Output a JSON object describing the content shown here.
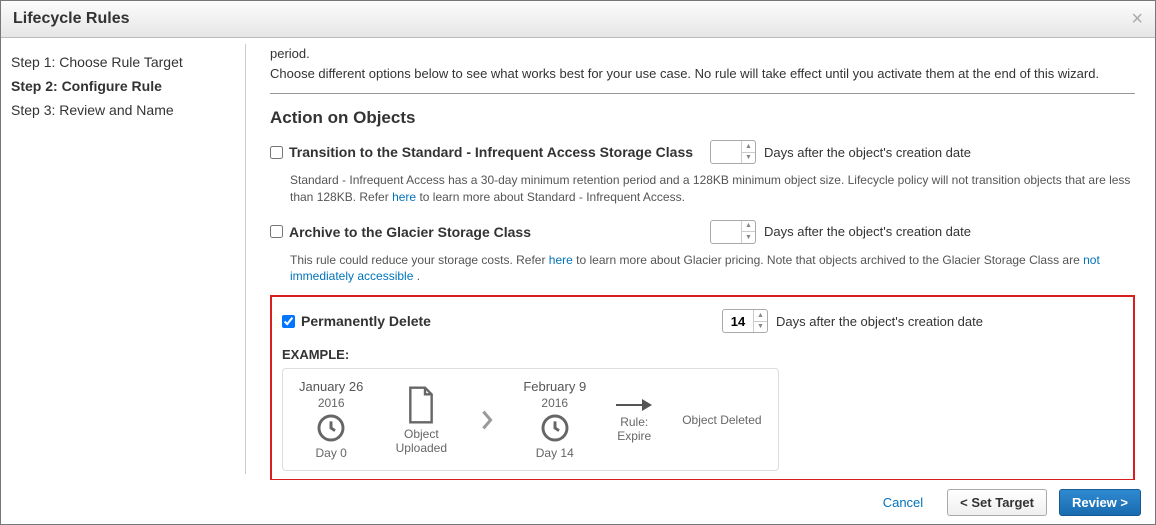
{
  "header": {
    "title": "Lifecycle Rules"
  },
  "sidebar": {
    "items": [
      {
        "label": "Step 1: Choose Rule Target",
        "active": false
      },
      {
        "label": "Step 2: Configure Rule",
        "active": true
      },
      {
        "label": "Step 3: Review and Name",
        "active": false
      }
    ]
  },
  "intro": {
    "line1": "period.",
    "line2": "Choose different options below to see what works best for your use case. No rule will take effect until you activate them at the end of this wizard."
  },
  "section": {
    "title": "Action on Objects"
  },
  "actions": {
    "ia": {
      "label": "Transition to the Standard - Infrequent Access Storage Class",
      "checked": false,
      "days": "",
      "suffix": "Days after the object's creation date",
      "help_a": "Standard - Infrequent Access has a 30-day minimum retention period and a 128KB minimum object size. Lifecycle policy will not transition objects that are less than 128KB. Refer ",
      "help_link": "here",
      "help_b": " to learn more about Standard - Infrequent Access."
    },
    "glacier": {
      "label": "Archive to the Glacier Storage Class",
      "checked": false,
      "days": "",
      "suffix": "Days after the object's creation date",
      "help_a": "This rule could reduce your storage costs. Refer ",
      "help_link1": "here",
      "help_b": " to learn more about Glacier pricing. Note that objects archived to the Glacier Storage Class are ",
      "help_link2": "not immediately accessible",
      "help_c": " ."
    },
    "delete": {
      "label": "Permanently Delete",
      "checked": true,
      "days": "14",
      "suffix": "Days after the object's creation date"
    }
  },
  "example": {
    "label": "EXAMPLE:",
    "date1": "January 26",
    "year1": "2016",
    "day0": "Day 0",
    "uploaded": "Object Uploaded",
    "date2": "February 9",
    "year2": "2016",
    "day14": "Day 14",
    "rule": "Rule: Expire",
    "deleted": "Object Deleted"
  },
  "footer": {
    "cancel": "Cancel",
    "back": "< Set Target",
    "next": "Review >"
  }
}
